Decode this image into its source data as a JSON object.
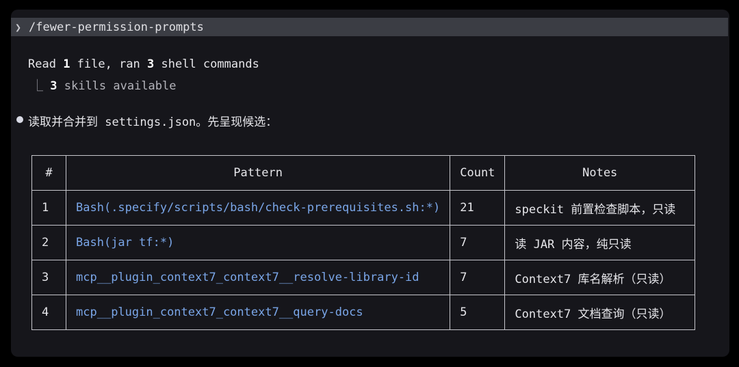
{
  "prompt": {
    "chevron": "❯",
    "command": "/fewer-permission-prompts"
  },
  "summary": {
    "prefix": "Read ",
    "files_count": "1",
    "mid": " file, ran ",
    "shell_count": "3",
    "suffix": " shell commands"
  },
  "skills": {
    "tree": "⎿",
    "count": "3",
    "label": " skills available"
  },
  "message": "读取并合并到 settings.json。先呈现候选：",
  "table": {
    "headers": [
      "#",
      "Pattern",
      "Count",
      "Notes"
    ],
    "rows": [
      {
        "num": "1",
        "pattern": "Bash(.specify/scripts/bash/check-prerequisites.sh:*)",
        "count": "21",
        "notes": "speckit 前置检查脚本，只读"
      },
      {
        "num": "2",
        "pattern": "Bash(jar tf:*)",
        "count": "7",
        "notes": "读 JAR 内容，纯只读"
      },
      {
        "num": "3",
        "pattern": "mcp__plugin_context7_context7__resolve-library-id",
        "count": "7",
        "notes": "Context7 库名解析（只读）"
      },
      {
        "num": "4",
        "pattern": "mcp__plugin_context7_context7__query-docs",
        "count": "5",
        "notes": "Context7 文档查询（只读）"
      }
    ]
  },
  "colors": {
    "background": "#16161b",
    "prompt_bar": "#3b3d44",
    "pattern_text": "#7aa6e8",
    "table_border": "#c6c6cc"
  }
}
